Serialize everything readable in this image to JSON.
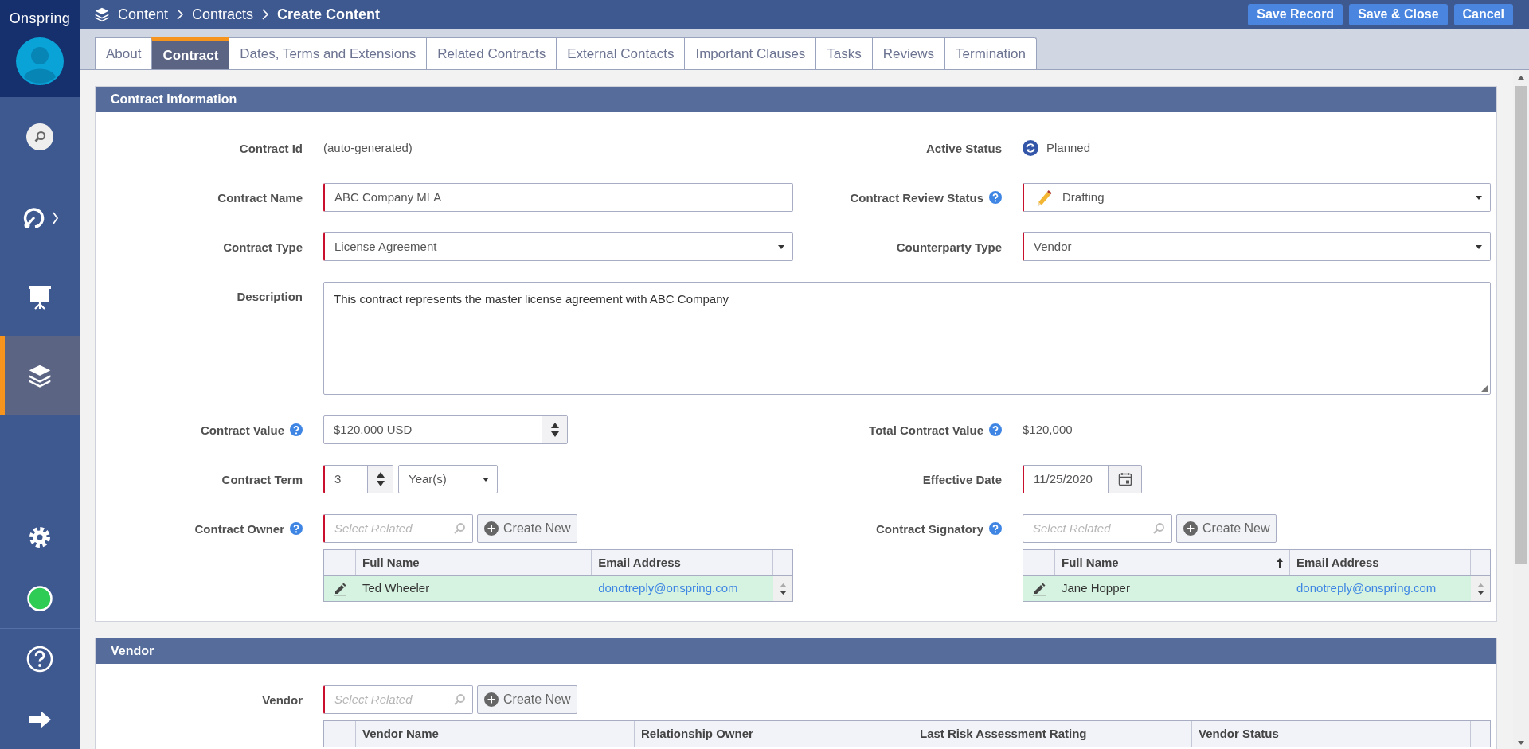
{
  "app": {
    "logo": "Onspring"
  },
  "sidebar": {
    "items": [
      {
        "kind": "search",
        "selected": false
      },
      {
        "kind": "dashboard",
        "selected": false
      },
      {
        "kind": "report",
        "selected": false
      },
      {
        "kind": "content",
        "selected": true
      },
      {
        "kind": "settings",
        "selected": false
      },
      {
        "kind": "status",
        "selected": false
      },
      {
        "kind": "help",
        "selected": false
      },
      {
        "kind": "logout",
        "selected": false
      }
    ]
  },
  "breadcrumb": [
    {
      "label": "Content",
      "current": false
    },
    {
      "label": "Contracts",
      "current": false
    },
    {
      "label": "Create Content",
      "current": true
    }
  ],
  "actions": [
    "Save Record",
    "Save & Close",
    "Cancel"
  ],
  "tabs": [
    {
      "label": "About",
      "selected": false
    },
    {
      "label": "Contract",
      "selected": true
    },
    {
      "label": "Dates, Terms and Extensions",
      "selected": false
    },
    {
      "label": "Related Contracts",
      "selected": false
    },
    {
      "label": "External Contacts",
      "selected": false
    },
    {
      "label": "Important Clauses",
      "selected": false
    },
    {
      "label": "Tasks",
      "selected": false
    },
    {
      "label": "Reviews",
      "selected": false
    },
    {
      "label": "Termination",
      "selected": false
    }
  ],
  "sections": [
    {
      "title": "Contract Information",
      "rows": [
        [
          {
            "kind": "readonly",
            "label": "Contract Id",
            "help": false,
            "value": "(auto-generated)"
          },
          {
            "kind": "status",
            "label": "Active Status",
            "help": false,
            "value": "Planned"
          }
        ],
        [
          {
            "kind": "text",
            "label": "Contract Name",
            "help": false,
            "required": true,
            "value": "ABC Company MLA"
          },
          {
            "kind": "icon-select",
            "label": "Contract Review Status",
            "help": true,
            "required": true,
            "value": "Drafting"
          }
        ],
        [
          {
            "kind": "select",
            "label": "Contract Type",
            "help": false,
            "required": true,
            "value": "License Agreement"
          },
          {
            "kind": "select",
            "label": "Counterparty Type",
            "help": false,
            "required": true,
            "value": "Vendor"
          }
        ],
        [
          {
            "kind": "textarea",
            "label": "Description",
            "help": false,
            "required": false,
            "value": "This contract represents the master license agreement with ABC Company"
          }
        ],
        [
          {
            "kind": "currency",
            "label": "Contract Value",
            "help": true,
            "required": false,
            "value": "$120,000 USD"
          },
          {
            "kind": "readonly",
            "label": "Total Contract Value",
            "help": true,
            "value": "$120,000"
          }
        ],
        [
          {
            "kind": "term",
            "label": "Contract Term",
            "help": false,
            "required": true,
            "value": "3",
            "unit": "Year(s)"
          },
          {
            "kind": "date",
            "label": "Effective Date",
            "help": false,
            "required": true,
            "value": "11/25/2020"
          }
        ],
        [
          {
            "kind": "reference",
            "label": "Contract Owner",
            "help": true,
            "required": true,
            "placeholder": "Select Related",
            "button": "Create New",
            "columns": [
              {
                "label": "Full Name",
                "sorted": false
              },
              {
                "label": "Email Address",
                "sorted": false
              }
            ],
            "rows": [
              {
                "added": true,
                "cells": [
                  "Ted Wheeler",
                  "donotreply@onspring.com"
                ]
              }
            ]
          },
          {
            "kind": "reference",
            "label": "Contract Signatory",
            "help": true,
            "required": false,
            "placeholder": "Select Related",
            "button": "Create New",
            "columns": [
              {
                "label": "Full Name",
                "sorted": true
              },
              {
                "label": "Email Address",
                "sorted": false
              }
            ],
            "rows": [
              {
                "added": true,
                "cells": [
                  "Jane Hopper",
                  "donotreply@onspring.com"
                ]
              }
            ]
          }
        ]
      ]
    },
    {
      "title": "Vendor",
      "rows": [
        [
          {
            "kind": "reference",
            "label": "Vendor",
            "help": false,
            "required": true,
            "placeholder": "Select Related",
            "button": "Create New",
            "columns": [
              {
                "label": "Vendor Name",
                "sorted": false
              },
              {
                "label": "Relationship Owner",
                "sorted": false
              },
              {
                "label": "Last Risk Assessment Rating",
                "sorted": false
              },
              {
                "label": "Vendor Status",
                "sorted": false
              }
            ]
          }
        ]
      ]
    }
  ]
}
